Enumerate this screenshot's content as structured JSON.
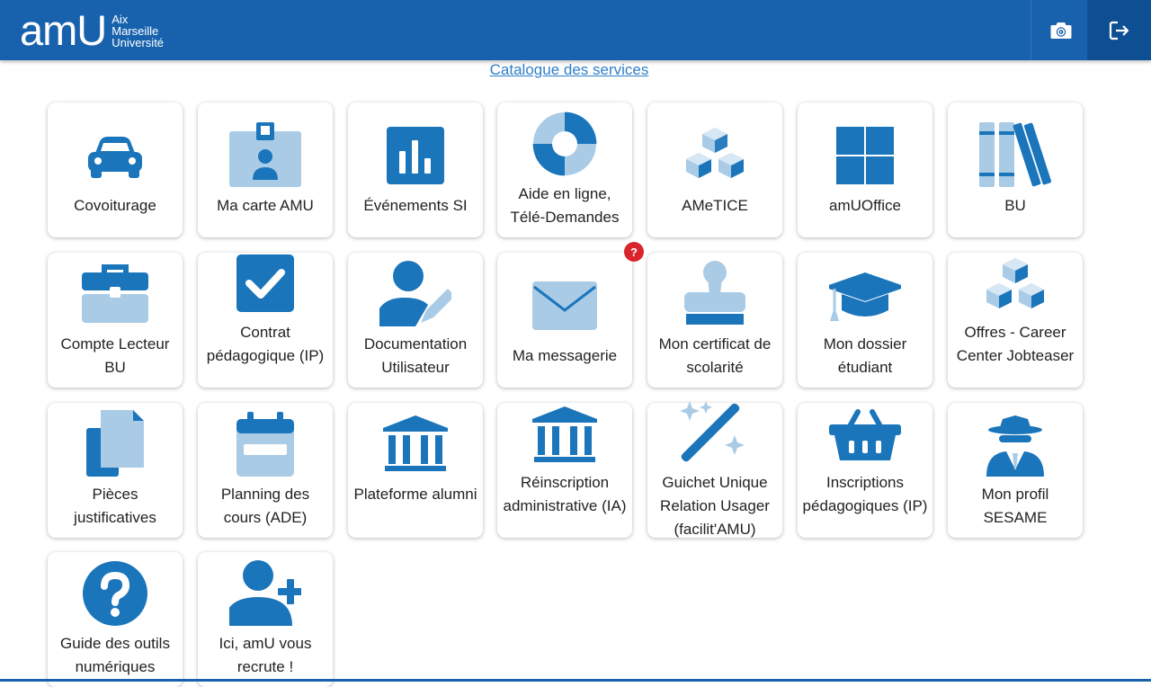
{
  "header": {
    "logo_text": "amU",
    "logo_sub": [
      "Aix",
      "Marseille",
      "Université"
    ],
    "screenshot_icon": "camera-icon",
    "logout_icon": "logout-icon"
  },
  "catalog_link": "Catalogue des services",
  "colors": {
    "header": "#1862ad",
    "icon_dark": "#1b75bb",
    "icon_light": "#a9cbe6",
    "badge": "#d9242b"
  },
  "tiles": [
    {
      "label": "Covoiturage",
      "icon": "car-icon"
    },
    {
      "label": "Ma carte AMU",
      "icon": "id-badge-icon"
    },
    {
      "label": "Événements SI",
      "icon": "bar-chart-icon"
    },
    {
      "label": "Aide en ligne, Télé-Demandes",
      "icon": "lifebuoy-icon"
    },
    {
      "label": "AMeTICE",
      "icon": "cubes-icon"
    },
    {
      "label": "amUOffice",
      "icon": "windows-icon"
    },
    {
      "label": "BU",
      "icon": "books-icon"
    },
    {
      "label": "Compte Lecteur BU",
      "icon": "toolbox-icon"
    },
    {
      "label": "Contrat pédagogique (IP)",
      "icon": "checkbox-icon"
    },
    {
      "label": "Documentation Utilisateur",
      "icon": "user-pen-icon"
    },
    {
      "label": "Ma messagerie",
      "icon": "envelope-icon",
      "badge": "?"
    },
    {
      "label": "Mon certificat de scolarité",
      "icon": "stamp-icon"
    },
    {
      "label": "Mon dossier étudiant",
      "icon": "graduation-cap-icon"
    },
    {
      "label": "Offres - Career Center Jobteaser",
      "icon": "cubes-icon"
    },
    {
      "label": "Pièces justificatives",
      "icon": "copy-icon"
    },
    {
      "label": "Planning des cours (ADE)",
      "icon": "calendar-icon"
    },
    {
      "label": "Plateforme alumni",
      "icon": "landmark-icon"
    },
    {
      "label": "Réinscription administrative (IA)",
      "icon": "landmark-icon"
    },
    {
      "label": "Guichet Unique Relation Usager (facilit'AMU)",
      "icon": "magic-wand-icon"
    },
    {
      "label": "Inscriptions pédagogiques (IP)",
      "icon": "basket-icon"
    },
    {
      "label": "Mon profil SESAME",
      "icon": "user-secret-icon"
    },
    {
      "label": "Guide des outils numériques",
      "icon": "question-circle-icon"
    },
    {
      "label": "Ici, amU vous recrute !",
      "icon": "user-plus-icon"
    }
  ]
}
